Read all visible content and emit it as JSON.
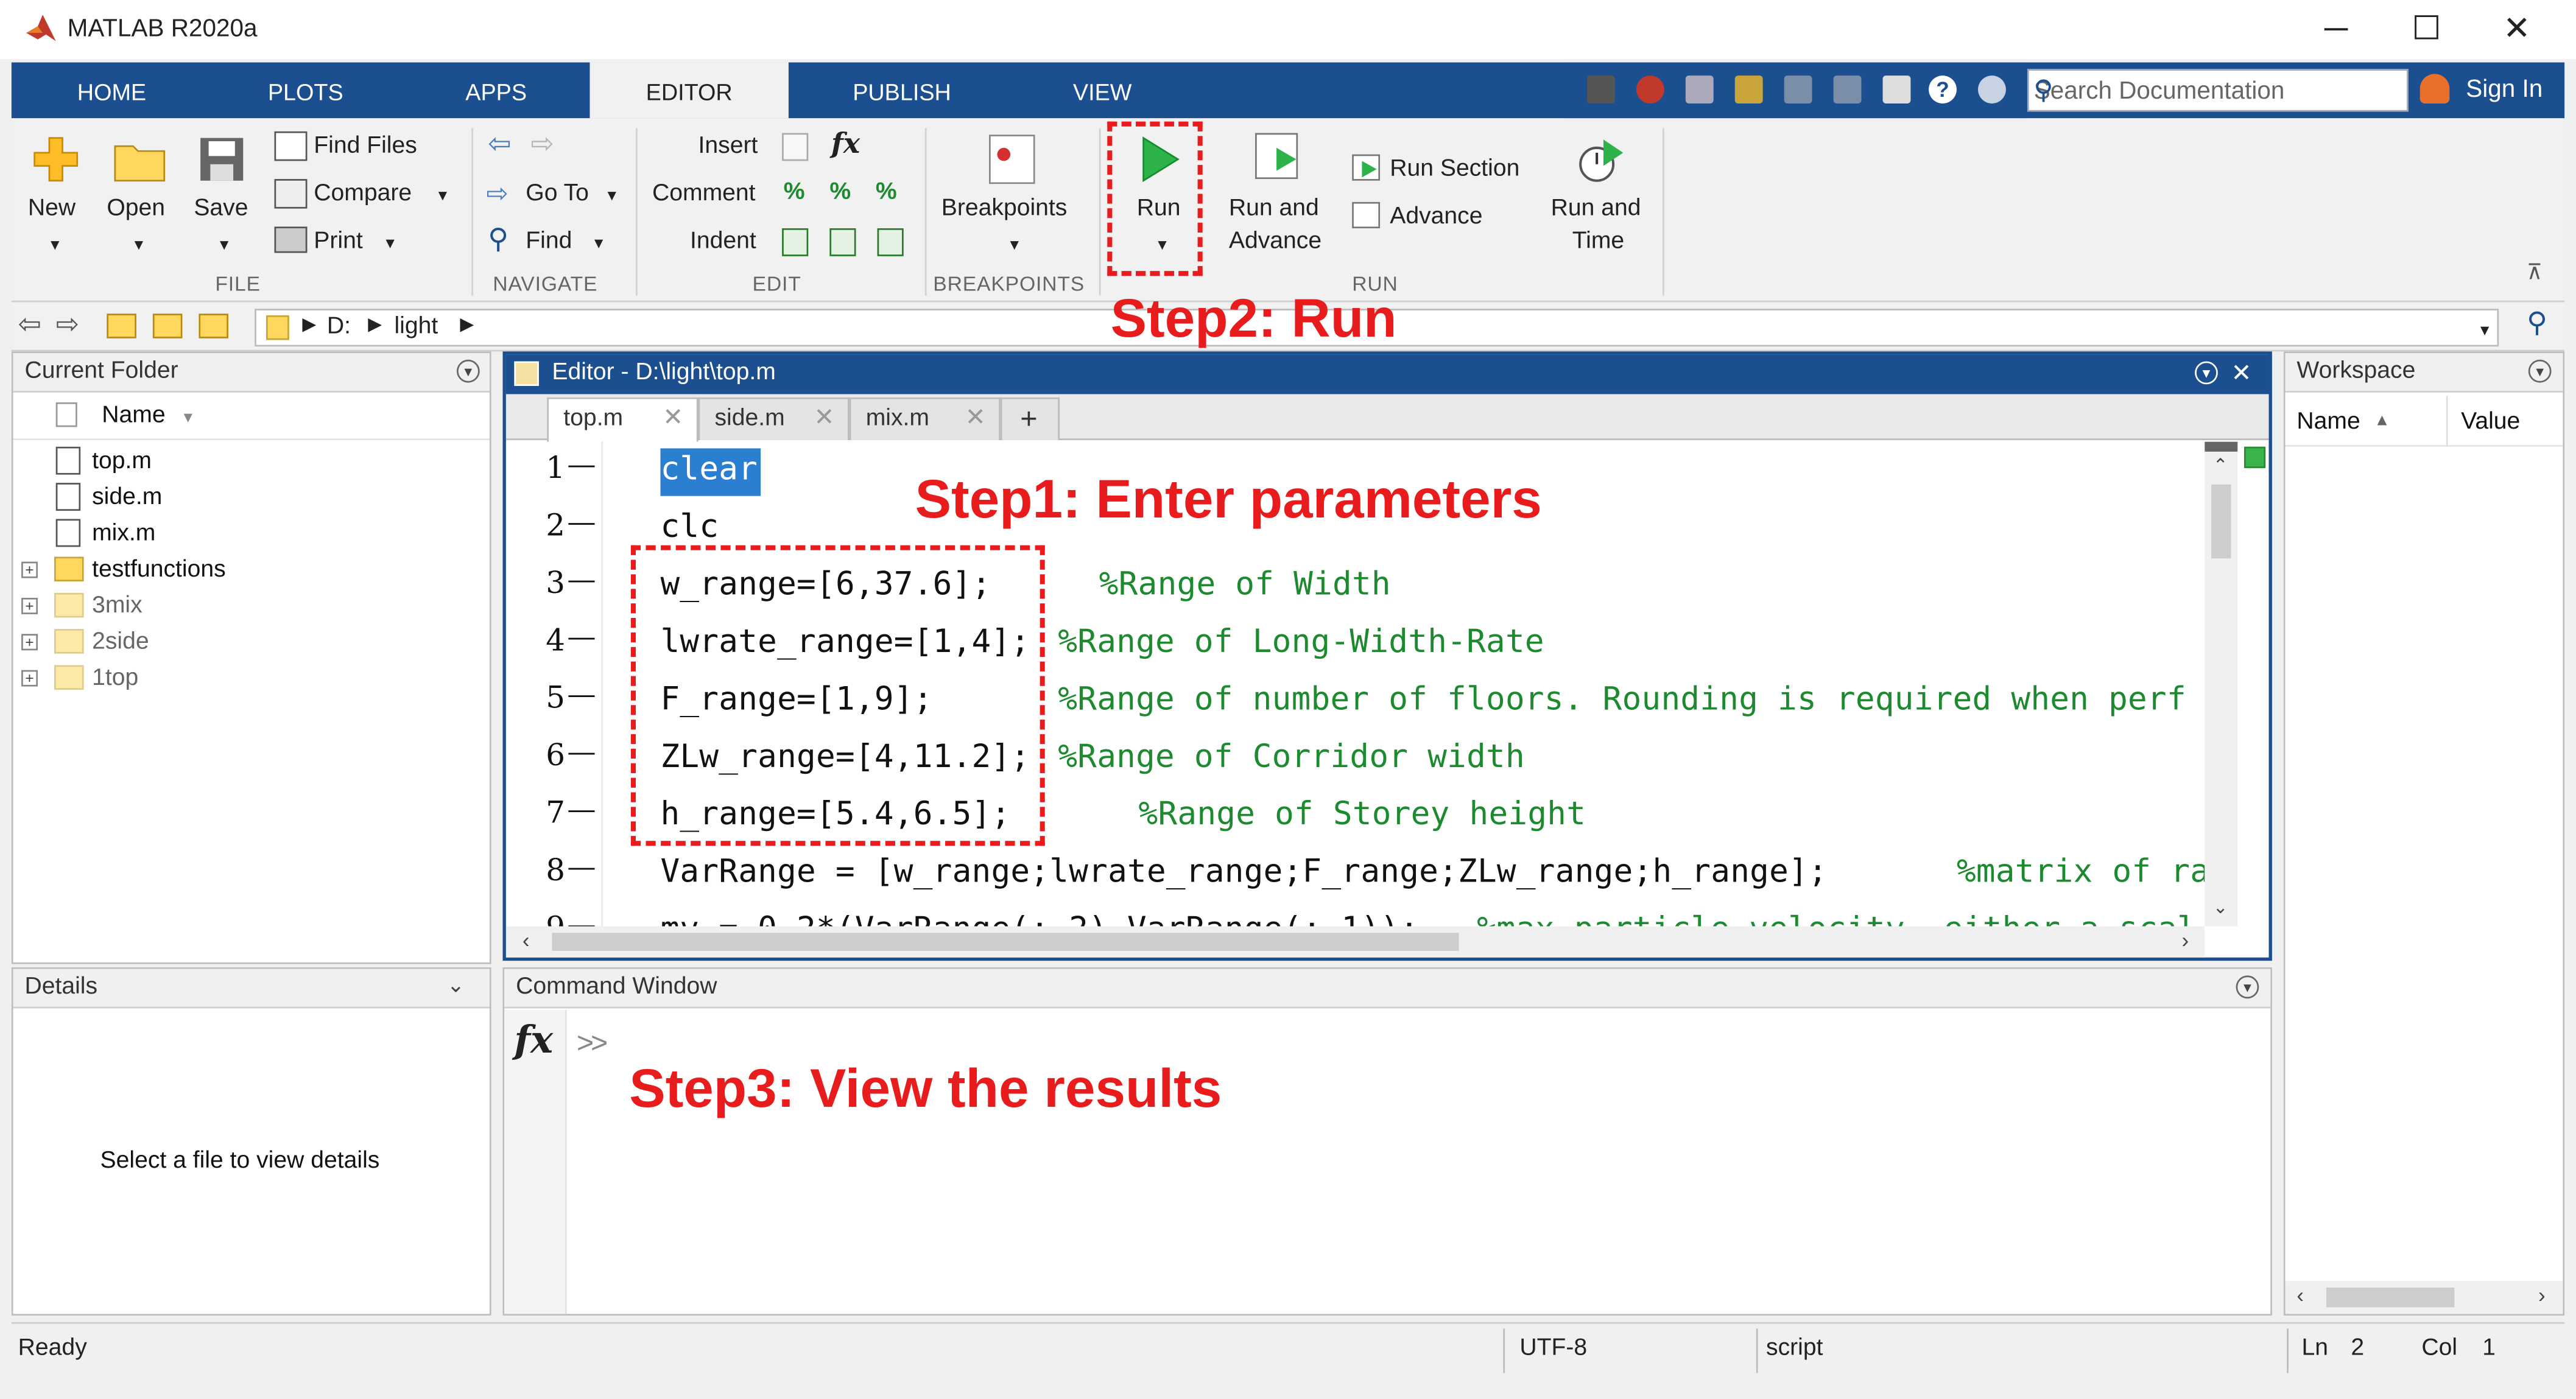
{
  "window": {
    "title": "MATLAB R2020a",
    "controls": [
      "─",
      "☐",
      "✕"
    ]
  },
  "tabs": [
    "HOME",
    "PLOTS",
    "APPS",
    "EDITOR",
    "PUBLISH",
    "VIEW"
  ],
  "active_tab": "EDITOR",
  "search": {
    "placeholder": "Search Documentation"
  },
  "sign_in": "Sign In",
  "ribbon": {
    "file": {
      "label": "FILE",
      "new": "New",
      "open": "Open",
      "save": "Save",
      "find_files": "Find Files",
      "compare": "Compare",
      "print": "Print"
    },
    "navigate": {
      "label": "NAVIGATE",
      "go_to": "Go To",
      "find": "Find"
    },
    "edit": {
      "label": "EDIT",
      "insert": "Insert",
      "comment": "Comment",
      "indent": "Indent"
    },
    "breakpoints": {
      "label": "BREAKPOINTS",
      "breakpoints": "Breakpoints"
    },
    "run": {
      "label": "RUN",
      "run": "Run",
      "run_and_advance_1": "Run and",
      "run_and_advance_2": "Advance",
      "run_section": "Run Section",
      "advance": "Advance",
      "run_and_time_1": "Run and",
      "run_and_time_2": "Time"
    }
  },
  "address": {
    "drive": "D:",
    "folder": "light"
  },
  "current_folder": {
    "title": "Current Folder",
    "column": "Name",
    "items": [
      {
        "name": "top.m",
        "type": "file"
      },
      {
        "name": "side.m",
        "type": "file"
      },
      {
        "name": "mix.m",
        "type": "file"
      },
      {
        "name": "testfunctions",
        "type": "folder"
      },
      {
        "name": "3mix",
        "type": "folder-dim"
      },
      {
        "name": "2side",
        "type": "folder-dim"
      },
      {
        "name": "1top",
        "type": "folder-dim"
      }
    ]
  },
  "details": {
    "title": "Details",
    "empty": "Select a file to view details"
  },
  "editor": {
    "title": "Editor - D:\\light\\top.m",
    "tabs": [
      "top.m",
      "side.m",
      "mix.m"
    ],
    "add_tab": "+",
    "lines": [
      {
        "n": "1",
        "code": "clear",
        "comment": ""
      },
      {
        "n": "2",
        "code": "clc",
        "comment": ""
      },
      {
        "n": "3",
        "code": "w_range=[6,37.6];",
        "comment": "%Range of Width"
      },
      {
        "n": "4",
        "code": "lwrate_range=[1,4];",
        "comment": "%Range of Long-Width-Rate"
      },
      {
        "n": "5",
        "code": "F_range=[1,9];",
        "comment": "%Range of number of floors. Rounding is required when perf"
      },
      {
        "n": "6",
        "code": "ZLw_range=[4,11.2];",
        "comment": "%Range of Corridor width"
      },
      {
        "n": "7",
        "code": "h_range=[5.4,6.5];",
        "comment": "%Range of Storey height"
      },
      {
        "n": "8",
        "code": "VarRange = [w_range;lwrate_range;F_range;ZLw_range;h_range];",
        "comment": "%matrix of ra"
      },
      {
        "n": "9",
        "code": "mv = 0.2*(VarRange(:,2)-VarRange(:,1));",
        "comment": "%max particle velocity, either a scal"
      }
    ]
  },
  "workspace": {
    "title": "Workspace",
    "col_name": "Name",
    "col_value": "Value"
  },
  "command_window": {
    "title": "Command Window",
    "fx": "fx",
    "prompt": ">>"
  },
  "annotations": {
    "step1": "Step1: Enter parameters",
    "step2": "Step2: Run",
    "step3": "Step3: View the results",
    "color": "#e81c1c"
  },
  "status": {
    "ready": "Ready",
    "encoding": "UTF-8",
    "type": "script",
    "ln_label": "Ln",
    "ln": "2",
    "col_label": "Col",
    "col": "1"
  }
}
